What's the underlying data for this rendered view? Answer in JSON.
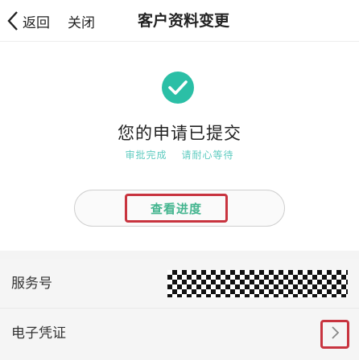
{
  "nav": {
    "back_label": "返回",
    "close_label": "关闭",
    "title": "客户资料变更"
  },
  "result": {
    "icon": "check-circle-icon",
    "title": "您的申请已提交",
    "subtitle_left": "审批完成",
    "subtitle_right": "请耐心等待",
    "button_label": "查看进度"
  },
  "rows": [
    {
      "label": "服务号",
      "value": ""
    },
    {
      "label": "电子凭证",
      "action_icon": "chevron-right-icon"
    }
  ],
  "colors": {
    "accent_teal": "#2bbfa6",
    "highlight_red": "#c8343f",
    "button_text_green": "#44b58f"
  }
}
